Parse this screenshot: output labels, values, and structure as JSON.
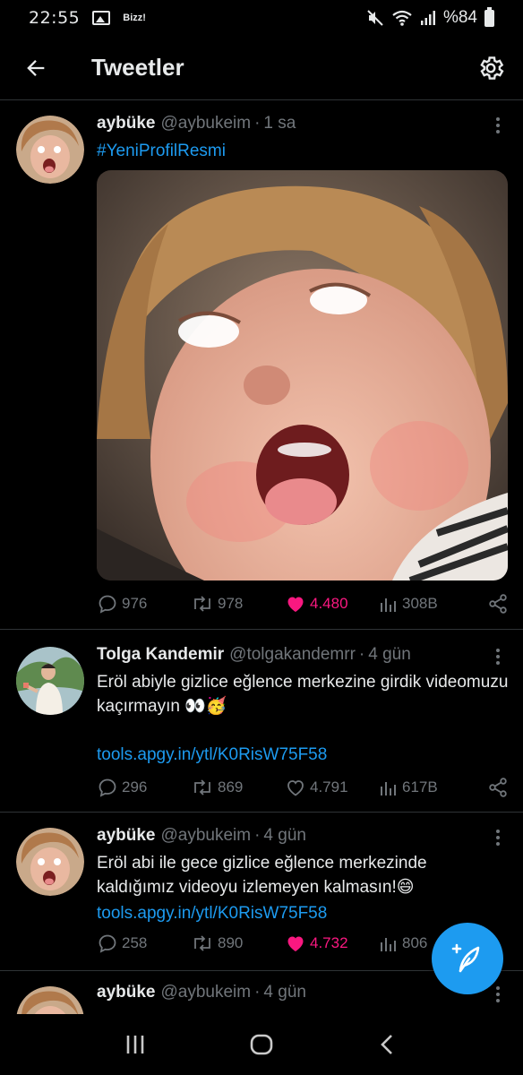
{
  "status_bar": {
    "time": "22:55",
    "app_label": "Bizz!",
    "battery_text": "%84"
  },
  "header": {
    "title": "Tweetler"
  },
  "tweets": [
    {
      "display_name": "aybüke",
      "handle": "@aybukeim",
      "time": "1 sa",
      "text": "#YeniProfilResmi",
      "link": "",
      "stats": {
        "replies": "976",
        "retweets": "978",
        "likes": "4.480",
        "views": "308B"
      },
      "liked": true
    },
    {
      "display_name": "Tolga Kandemir",
      "handle": "@tolgakandemrr",
      "time": "4 gün",
      "text": "Eröl abiyle gizlice eğlence merkezine girdik videomuzu kaçırmayın 👀🥳",
      "link": "tools.apgy.in/ytl/K0RisW75F58",
      "stats": {
        "replies": "296",
        "retweets": "869",
        "likes": "4.791",
        "views": "617B"
      },
      "liked": false
    },
    {
      "display_name": "aybüke",
      "handle": "@aybukeim",
      "time": "4 gün",
      "text": "Eröl abi ile gece gizlice eğlence merkezinde kaldığımız videoyu izlemeyen kalmasın!😄",
      "link": "tools.apgy.in/ytl/K0RisW75F58",
      "stats": {
        "replies": "258",
        "retweets": "890",
        "likes": "4.732",
        "views": "806"
      },
      "liked": true
    },
    {
      "display_name": "aybüke",
      "handle": "@aybukeim",
      "time": "4 gün"
    }
  ],
  "colors": {
    "accent": "#1d9bf0",
    "like": "#f91880",
    "muted": "#71767b",
    "divider": "#2f3336"
  }
}
